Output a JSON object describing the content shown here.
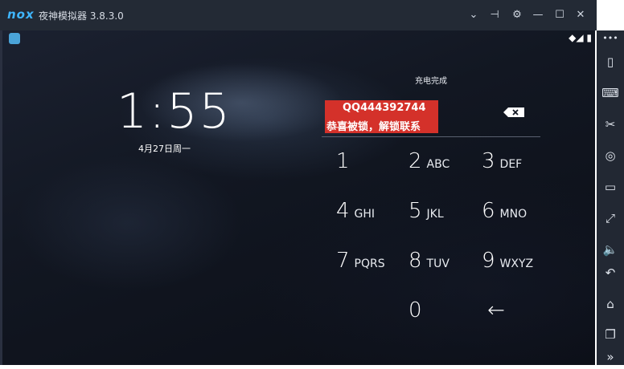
{
  "titlebar": {
    "logo": "nox",
    "title": "夜神模拟器 3.8.3.0",
    "buttons": [
      {
        "name": "chevron-down-icon",
        "glyph": "⌄"
      },
      {
        "name": "pin-icon",
        "glyph": "⊣"
      },
      {
        "name": "gear-icon",
        "glyph": "⚙"
      },
      {
        "name": "minimize-icon",
        "glyph": "—"
      },
      {
        "name": "maximize-icon",
        "glyph": "☐"
      },
      {
        "name": "close-icon",
        "glyph": "✕"
      }
    ]
  },
  "statusbar": {
    "icons": "◆◢ ▮"
  },
  "lockscreen": {
    "time": "1:55",
    "date": "4月27日周一",
    "charging": "充电完成",
    "pin_notice_line1": "QQ444392744",
    "pin_notice_line2": "恭喜被锁，解锁联系",
    "keys": [
      {
        "num": "1",
        "letters": ""
      },
      {
        "num": "2",
        "letters": "ABC"
      },
      {
        "num": "3",
        "letters": "DEF"
      },
      {
        "num": "4",
        "letters": "GHI"
      },
      {
        "num": "5",
        "letters": "JKL"
      },
      {
        "num": "6",
        "letters": "MNO"
      },
      {
        "num": "7",
        "letters": "PQRS"
      },
      {
        "num": "8",
        "letters": "TUV"
      },
      {
        "num": "9",
        "letters": "WXYZ"
      },
      {
        "num": "0",
        "letters": ""
      },
      {
        "num": "←",
        "letters": ""
      }
    ]
  },
  "sidebar": {
    "buttons": [
      {
        "name": "more-icon",
        "glyph": "•••"
      },
      {
        "name": "shake-icon",
        "glyph": "▯"
      },
      {
        "name": "keyboard-icon",
        "glyph": "⌨"
      },
      {
        "name": "scissors-icon",
        "glyph": "✂"
      },
      {
        "name": "location-icon",
        "glyph": "◎"
      },
      {
        "name": "screen-icon",
        "glyph": "▭"
      },
      {
        "name": "fullscreen-icon",
        "glyph": "⤢"
      },
      {
        "name": "volume-icon",
        "glyph": "🔈"
      },
      {
        "name": "back-icon",
        "glyph": "↶"
      },
      {
        "name": "home-icon",
        "glyph": "⌂"
      },
      {
        "name": "recents-icon",
        "glyph": "❐"
      },
      {
        "name": "expand-icon",
        "glyph": "»"
      }
    ]
  }
}
